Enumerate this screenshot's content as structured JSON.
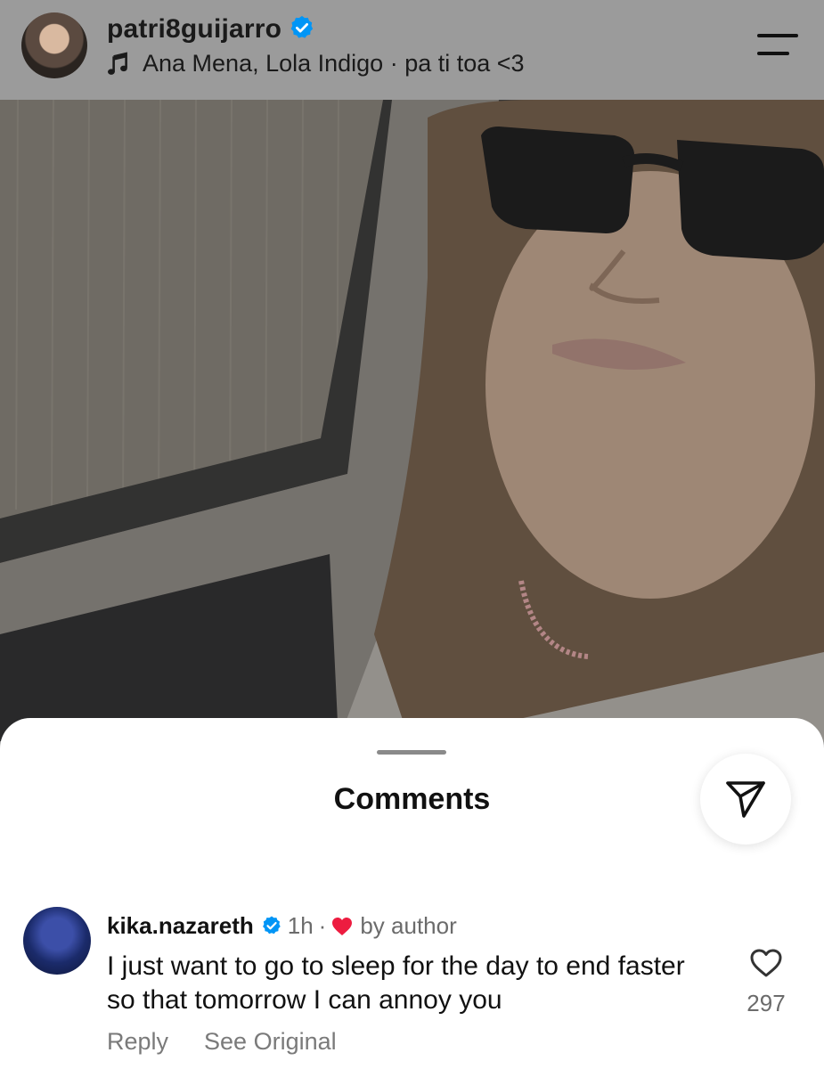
{
  "header": {
    "username": "patri8guijarro",
    "music": "Ana Mena, Lola Indigo · pa ti toa <3",
    "icons": {
      "verified": "verified-badge-icon",
      "music": "music-note-icon",
      "menu": "menu-icon"
    }
  },
  "sheet": {
    "title": "Comments",
    "share_icon": "send-icon"
  },
  "comment": {
    "username": "kika.nazareth",
    "time": "1h",
    "separator": "·",
    "liked_by_author": "by author",
    "text": "I just want to go to sleep for the day to end faster so that tomorrow I can annoy you",
    "like_count": "297",
    "reply_label": "Reply",
    "see_original_label": "See Original"
  },
  "colors": {
    "verified_blue": "#0095f6",
    "heart_red": "#ed1c40",
    "secondary_text": "#737373"
  }
}
